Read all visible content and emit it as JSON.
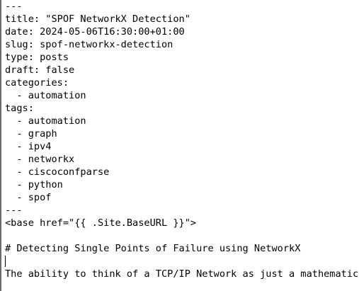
{
  "document": {
    "lines": [
      "---",
      "title: \"SPOF NetworkX Detection\"",
      "date: 2024-05-06T16:30:00+01:00",
      "slug: spof-networkx-detection",
      "type: posts",
      "draft: false",
      "categories:",
      "  - automation",
      "tags:",
      "  - automation",
      "  - graph",
      "  - ipv4",
      "  - networkx",
      "  - ciscoconfparse",
      "  - python",
      "  - spof",
      "---",
      "<base href=\"{{ .Site.BaseURL }}\">",
      "",
      "# Detecting Single Points of Failure using NetworkX",
      "",
      "The ability to think of a TCP/IP Network as just a mathematical"
    ]
  }
}
